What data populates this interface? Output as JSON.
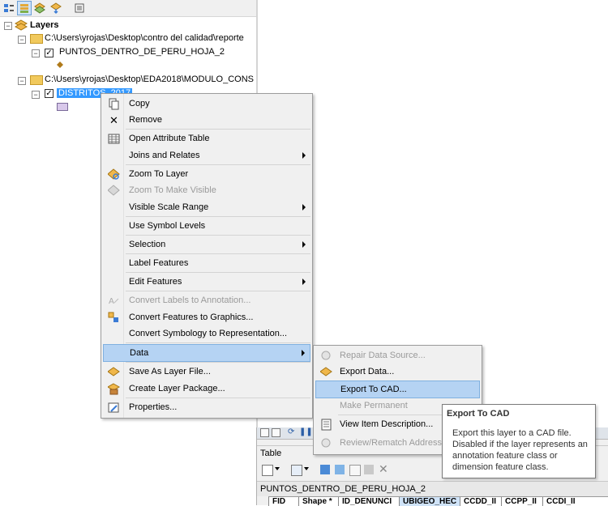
{
  "toc": {
    "root_label": "Layers",
    "group1_path": "C:\\Users\\yrojas\\Desktop\\contro del calidad\\reporte",
    "layer1_name": "PUNTOS_DENTRO_DE_PERU_HOJA_2",
    "group2_path": "C:\\Users\\yrojas\\Desktop\\EDA2018\\MODULO_CONS",
    "layer2_name": "DISTRITOS_2017"
  },
  "context_menu": {
    "items": [
      {
        "label": "Copy"
      },
      {
        "label": "Remove"
      },
      {
        "label": "Open Attribute Table"
      },
      {
        "label": "Joins and Relates"
      },
      {
        "label": "Zoom To Layer"
      },
      {
        "label": "Zoom To Make Visible"
      },
      {
        "label": "Visible Scale Range"
      },
      {
        "label": "Use Symbol Levels"
      },
      {
        "label": "Selection"
      },
      {
        "label": "Label Features"
      },
      {
        "label": "Edit Features"
      },
      {
        "label": "Convert Labels to Annotation..."
      },
      {
        "label": "Convert Features to Graphics..."
      },
      {
        "label": "Convert Symbology to Representation..."
      },
      {
        "label": "Data"
      },
      {
        "label": "Save As Layer File..."
      },
      {
        "label": "Create Layer Package..."
      },
      {
        "label": "Properties..."
      }
    ]
  },
  "data_submenu": {
    "items": [
      {
        "label": "Repair Data Source..."
      },
      {
        "label": "Export Data..."
      },
      {
        "label": "Export To CAD..."
      },
      {
        "label": "Make Permanent"
      },
      {
        "label": "View Item Description..."
      },
      {
        "label": "Review/Rematch Addresses..."
      }
    ]
  },
  "tooltip": {
    "title": "Export To CAD",
    "body": "Export this layer to a CAD file. Disabled if the layer represents an annotation feature class or dimension feature class."
  },
  "table_window": {
    "title": "Table",
    "tab_label": "PUNTOS_DENTRO_DE_PERU_HOJA_2",
    "columns": [
      "FID",
      "Shape *",
      "ID_DENUNCI",
      "UBIGEO_HEC",
      "CCDD_II",
      "CCPP_II",
      "CCDI_II"
    ]
  },
  "colors": {
    "highlight": "#b5d3f3",
    "selection": "#3399ff",
    "menu_bg": "#f0f0f0"
  }
}
